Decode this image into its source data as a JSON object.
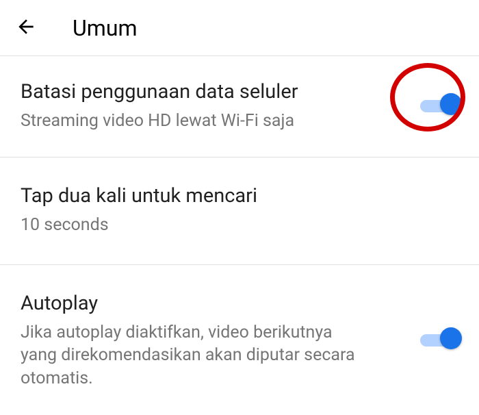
{
  "header": {
    "title": "Umum"
  },
  "settings": {
    "limit_data": {
      "title": "Batasi penggunaan data seluler",
      "subtitle": "Streaming video HD lewat Wi-Fi saja",
      "toggle_on": true
    },
    "double_tap": {
      "title": "Tap dua kali untuk mencari",
      "subtitle": "10 seconds"
    },
    "autoplay": {
      "title": "Autoplay",
      "subtitle": "Jika autoplay diaktifkan, video berikutnya yang direkomendasikan akan diputar secara otomatis.",
      "toggle_on": true
    }
  }
}
